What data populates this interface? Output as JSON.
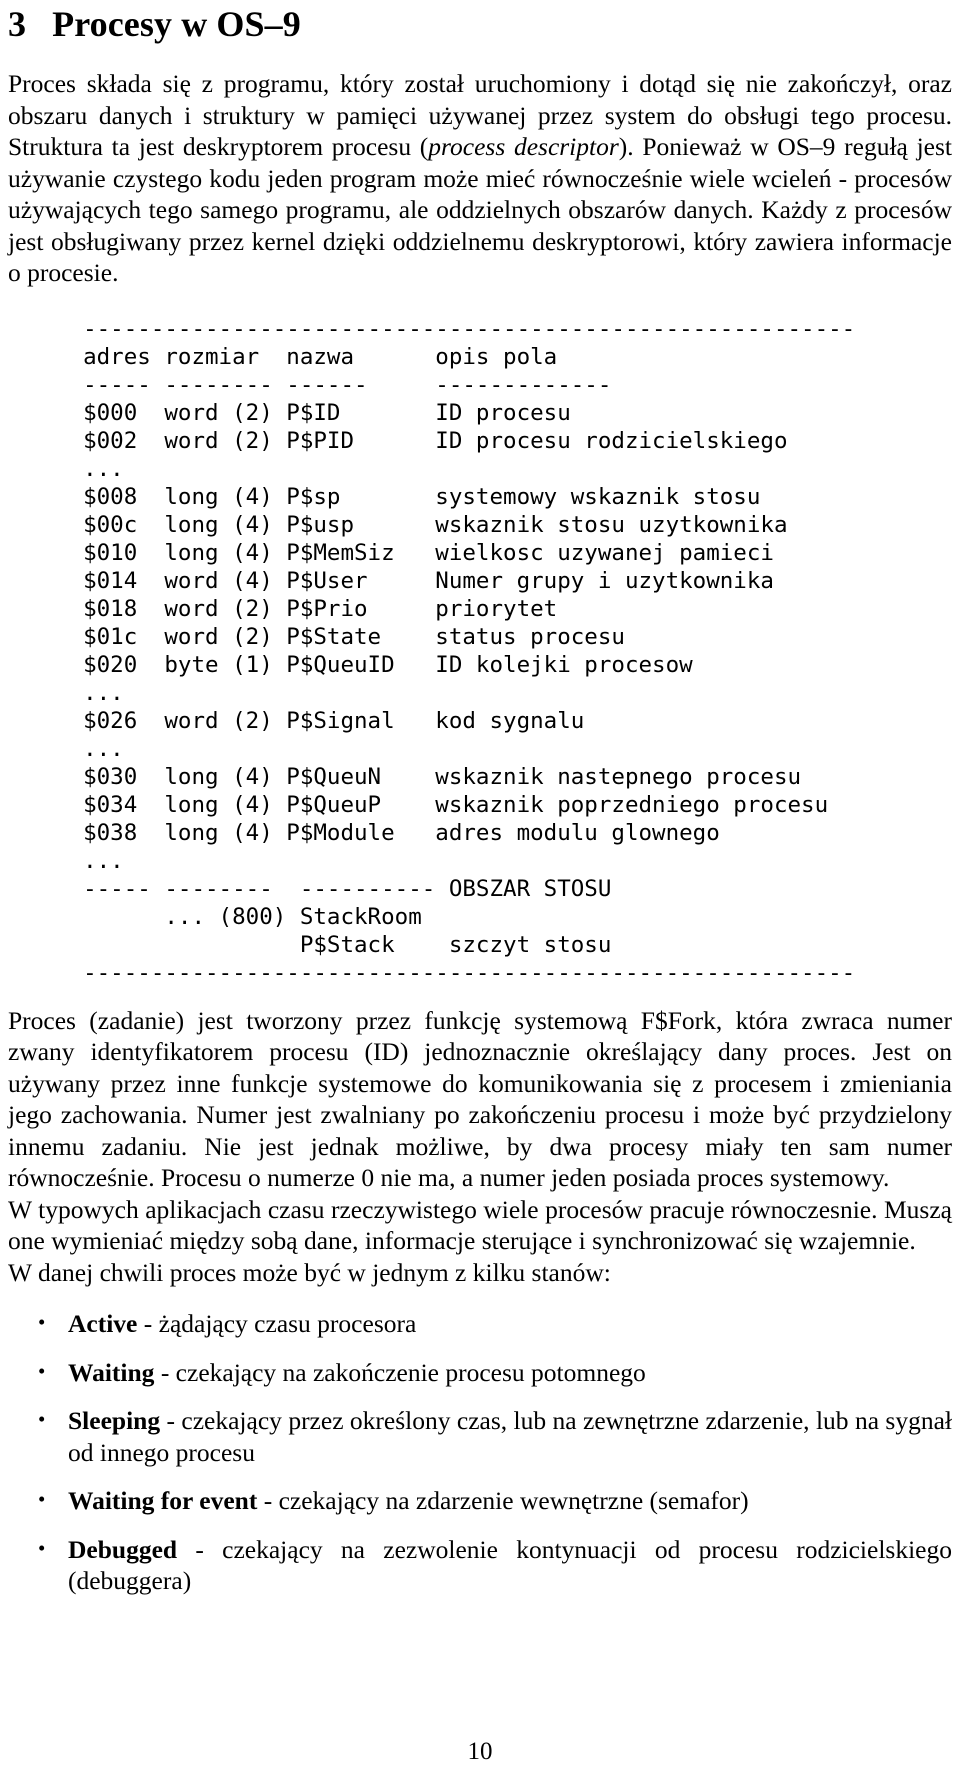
{
  "document": {
    "language": "pl",
    "page_number": "10"
  },
  "heading": {
    "number": "3",
    "title": "Procesy w OS–9",
    "full": "3   Procesy w OS–9"
  },
  "intro_paragraph": {
    "part1": "Proces składa się z programu, który został uruchomiony i dotąd się nie zakończył, oraz obszaru danych i struktury w pamięci używanej przez system do obsługi tego procesu. Struktura ta jest deskryptorem procesu (",
    "italic": "process descriptor",
    "part2": "). Ponieważ w OS–9 regułą jest używanie czystego kodu jeden program może mieć równocześnie wiele wcieleń - procesów używających tego samego programu, ale oddzielnych obszarów danych. Każdy z procesów jest obsługiwany przez kernel dzięki oddzielnemu deskryptorowi, który zawiera informacje o procesie."
  },
  "descriptor_table": {
    "top_rule": "---------------------------------------------------------",
    "headers": [
      "adres",
      "rozmiar",
      "nazwa",
      "opis pola"
    ],
    "header_rule": [
      "-----",
      "--------",
      "------",
      "-------------"
    ],
    "rows": [
      {
        "adres": "$000",
        "rozmiar": "word (2)",
        "nazwa": "P$ID",
        "opis": "ID procesu"
      },
      {
        "adres": "$002",
        "rozmiar": "word (2)",
        "nazwa": "P$PID",
        "opis": "ID procesu rodzicielskiego"
      },
      {
        "ellipsis": "..."
      },
      {
        "adres": "$008",
        "rozmiar": "long (4)",
        "nazwa": "P$sp",
        "opis": "systemowy wskaznik stosu"
      },
      {
        "adres": "$00c",
        "rozmiar": "long (4)",
        "nazwa": "P$usp",
        "opis": "wskaznik stosu uzytkownika"
      },
      {
        "adres": "$010",
        "rozmiar": "long (4)",
        "nazwa": "P$MemSiz",
        "opis": "wielkosc uzywanej pamieci"
      },
      {
        "adres": "$014",
        "rozmiar": "word (4)",
        "nazwa": "P$User",
        "opis": "Numer grupy i uzytkownika"
      },
      {
        "adres": "$018",
        "rozmiar": "word (2)",
        "nazwa": "P$Prio",
        "opis": "priorytet"
      },
      {
        "adres": "$01c",
        "rozmiar": "word (2)",
        "nazwa": "P$State",
        "opis": "status procesu"
      },
      {
        "adres": "$020",
        "rozmiar": "byte (1)",
        "nazwa": "P$QueuID",
        "opis": "ID kolejki procesow"
      },
      {
        "ellipsis": "..."
      },
      {
        "adres": "$026",
        "rozmiar": "word (2)",
        "nazwa": "P$Signal",
        "opis": "kod sygnalu"
      },
      {
        "ellipsis": "..."
      },
      {
        "adres": "$030",
        "rozmiar": "long (4)",
        "nazwa": "P$QueuN",
        "opis": "wskaznik nastepnego procesu"
      },
      {
        "adres": "$034",
        "rozmiar": "long (4)",
        "nazwa": "P$QueuP",
        "opis": "wskaznik poprzedniego procesu"
      },
      {
        "adres": "$038",
        "rozmiar": "long (4)",
        "nazwa": "P$Module",
        "opis": "adres modulu glownego"
      },
      {
        "ellipsis": "..."
      }
    ],
    "stack_rule": "----- --------  ---------- OBSZAR STOSU",
    "stack_rows": [
      {
        "adres": "",
        "rozmiar": "... (800)",
        "nazwa": "StackRoom",
        "opis": ""
      },
      {
        "adres": "",
        "rozmiar": "",
        "nazwa": "P$Stack",
        "opis": "szczyt stosu"
      }
    ],
    "bottom_rule": "---------------------------------------------------------",
    "rendered": "  ---------------------------------------------------------\n  adres rozmiar  nazwa      opis pola\n  ----- -------- ------     -------------\n  $000  word (2) P$ID       ID procesu\n  $002  word (2) P$PID      ID procesu rodzicielskiego\n  ...\n  $008  long (4) P$sp       systemowy wskaznik stosu\n  $00c  long (4) P$usp      wskaznik stosu uzytkownika\n  $010  long (4) P$MemSiz   wielkosc uzywanej pamieci\n  $014  word (4) P$User     Numer grupy i uzytkownika\n  $018  word (2) P$Prio     priorytet\n  $01c  word (2) P$State    status procesu\n  $020  byte (1) P$QueuID   ID kolejki procesow\n  ...\n  $026  word (2) P$Signal   kod sygnalu\n  ...\n  $030  long (4) P$QueuN    wskaznik nastepnego procesu\n  $034  long (4) P$QueuP    wskaznik poprzedniego procesu\n  $038  long (4) P$Module   adres modulu glownego\n  ...\n  ----- --------  ---------- OBSZAR STOSU\n        ... (800) StackRoom\n                  P$Stack    szczyt stosu\n  ---------------------------------------------------------"
  },
  "after_table_paragraph": {
    "text": "Proces (zadanie) jest tworzony przez funkcję systemową F$Fork, która zwraca numer zwany identyfikatorem procesu (ID) jednoznacznie określający dany proces. Jest on używany przez inne funkcje systemowe do komunikowania się z procesem i zmieniania jego zachowania. Numer jest zwalniany po zakończeniu procesu i może być przydzielony innemu zadaniu. Nie jest jednak możliwe, by dwa procesy miały ten sam numer równocześnie. Procesu o numerze 0 nie ma, a numer jeden posiada proces systemowy."
  },
  "realtime_paragraph": {
    "text": "W typowych aplikacjach czasu rzeczywistego wiele procesów pracuje równoczesnie. Muszą one wymieniać między sobą dane, informacje sterujące i synchronizować się wzajemnie."
  },
  "states_intro": {
    "text": "W danej chwili proces może być w jednym z kilku stanów:"
  },
  "states": [
    {
      "term": "Active",
      "description": " - żądający czasu procesora"
    },
    {
      "term": "Waiting",
      "description": " - czekający na zakończenie procesu potomnego"
    },
    {
      "term": "Sleeping",
      "description": " - czekający przez określony czas, lub na zewnętrzne zdarzenie, lub na sygnał od innego procesu"
    },
    {
      "term": "Waiting for event",
      "description": " - czekający na zdarzenie wewnętrzne (semafor)"
    },
    {
      "term": "Debugged",
      "description": " - czekający na zezwolenie kontynuacji od procesu rodzicielskiego (debuggera)"
    }
  ]
}
